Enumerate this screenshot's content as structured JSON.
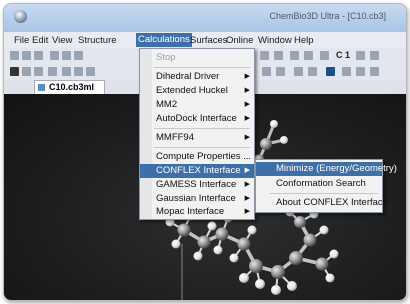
{
  "window": {
    "title": "ChemBio3D Ultra - [C10.cb3]"
  },
  "menubar": {
    "items": [
      "File",
      "Edit",
      "View",
      "Structure",
      "Calculations",
      "Surfaces",
      "Online",
      "Window",
      "Help"
    ],
    "active_index": 4
  },
  "toolbar": {
    "right_text": "C 1"
  },
  "document": {
    "tab_label": "C10.cb3ml"
  },
  "calculations_menu": {
    "items": [
      {
        "label": "Stop",
        "disabled": true,
        "submenu": false
      },
      {
        "label": "Dihedral Driver",
        "disabled": false,
        "submenu": true
      },
      {
        "label": "Extended Huckel",
        "disabled": false,
        "submenu": true
      },
      {
        "label": "MM2",
        "disabled": false,
        "submenu": true
      },
      {
        "label": "AutoDock Interface",
        "disabled": false,
        "submenu": true
      },
      {
        "label": "MMFF94",
        "disabled": false,
        "submenu": true
      },
      {
        "label": "Compute Properties ...",
        "disabled": false,
        "submenu": false
      },
      {
        "label": "CONFLEX Interface",
        "disabled": false,
        "submenu": true,
        "highlighted": true
      },
      {
        "label": "GAMESS Interface",
        "disabled": false,
        "submenu": true
      },
      {
        "label": "Gaussian Interface",
        "disabled": false,
        "submenu": true
      },
      {
        "label": "Mopac Interface",
        "disabled": false,
        "submenu": true
      }
    ]
  },
  "conflex_submenu": {
    "items": [
      {
        "label": "Minimize (Energy/Geometry)",
        "highlighted": true
      },
      {
        "label": "Conformation Search",
        "highlighted": false
      },
      {
        "label": "About CONFLEX Interface",
        "highlighted": false
      }
    ]
  },
  "colors": {
    "highlight": "#3d6fa9",
    "viewport_bg": "#1c1d1e",
    "carbon_atom": "#9a9a9a",
    "hydrogen_atom": "#ffffff"
  }
}
